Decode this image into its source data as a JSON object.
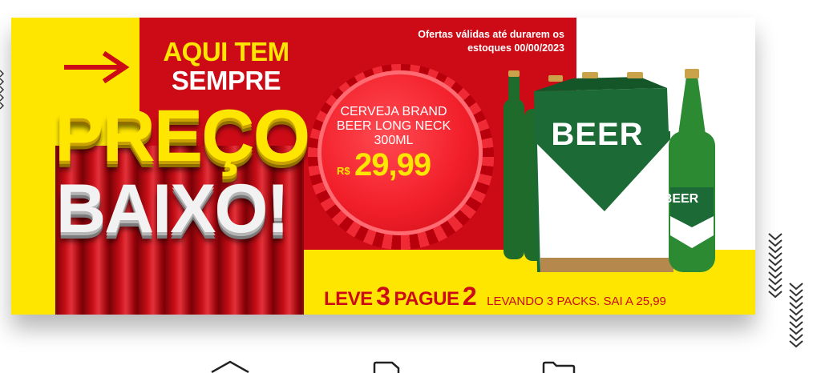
{
  "banner": {
    "headline_line1": "AQUI TEM",
    "headline_line2": "SEMPRE",
    "headline_big1": "PREÇO",
    "headline_big2": "BAIXO!",
    "validity": "Ofertas válidas até durarem os estoques 00/00/2023",
    "product_name": "CERVEJA BRAND BEER LONG NECK 300ML",
    "currency": "R$",
    "price": "29,99",
    "pack_label": "BEER",
    "bottle_label": "BEER",
    "promo_leve": "LEVE",
    "promo_num1": "3",
    "promo_pague": "PAGUE",
    "promo_num2": "2",
    "promo_sub": "LEVANDO 3 PACKS. SAI A 25,99"
  },
  "colors": {
    "yellow": "#ffe600",
    "red": "#cc0b16",
    "green": "#1b6a30",
    "white": "#ffffff"
  },
  "icons": [
    "arrow-right-icon",
    "chevron-pattern-icon",
    "home-icon",
    "document-icon",
    "folder-icon"
  ]
}
